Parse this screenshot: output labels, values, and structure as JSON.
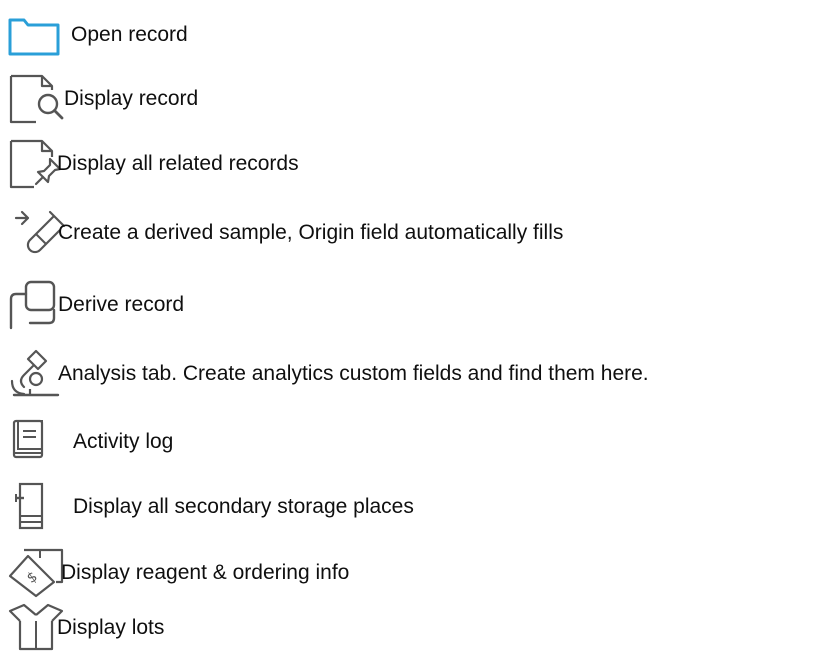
{
  "legend": {
    "items": [
      {
        "icon": "folder-icon",
        "label": "Open record"
      },
      {
        "icon": "document-search-icon",
        "label": "Display record"
      },
      {
        "icon": "document-pin-icon",
        "label": "Display all related records"
      },
      {
        "icon": "test-tube-derive-icon",
        "label": "Create a derived sample, Origin field automatically fills"
      },
      {
        "icon": "copy-squares-icon",
        "label": "Derive record"
      },
      {
        "icon": "microscope-icon",
        "label": "Analysis tab. Create analytics custom fields and find them here."
      },
      {
        "icon": "log-book-icon",
        "label": "Activity log"
      },
      {
        "icon": "storage-cabinet-icon",
        "label": "Display all secondary storage places"
      },
      {
        "icon": "price-tag-icon",
        "label": "Display reagent & ordering info"
      },
      {
        "icon": "open-box-icon",
        "label": "Display lots"
      }
    ]
  },
  "colors": {
    "folder_stroke": "#2a9fd8",
    "icon_stroke": "#555555",
    "text": "#0f0f0f",
    "background": "#ffffff"
  }
}
